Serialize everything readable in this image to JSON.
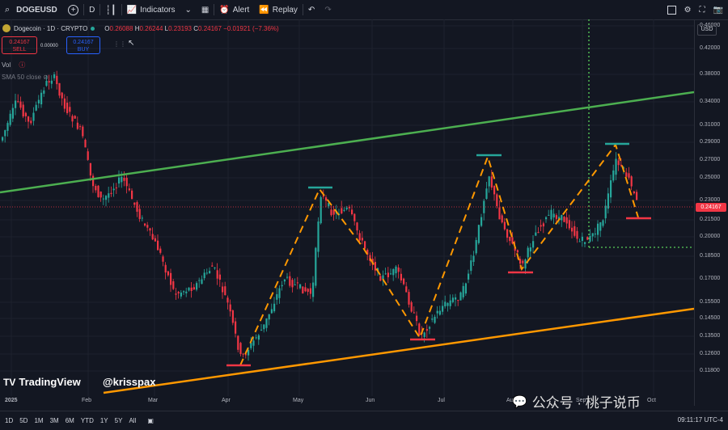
{
  "toolbar": {
    "symbol": "DOGEUSD",
    "interval": "D",
    "indicators_label": "Indicators",
    "alert_label": "Alert",
    "replay_label": "Replay"
  },
  "legend": {
    "title": "Dogecoin · 1D · CRYPTO",
    "o_key": "O",
    "o_val": "0.26088",
    "h_key": "H",
    "h_val": "0.26244",
    "l_key": "L",
    "l_val": "0.23193",
    "c_key": "C",
    "c_val": "0.24167",
    "change": "−0.01921 (−7.36%)"
  },
  "trade": {
    "sell_price": "0.24167",
    "sell_label": "SELL",
    "spread": "0.00000",
    "buy_price": "0.24167",
    "buy_label": "BUY"
  },
  "indicators": {
    "vol": "Vol",
    "sma": "SMA 50 close"
  },
  "price_axis": {
    "currency": "USD",
    "current": "0.24167",
    "labels": [
      "0.46000",
      "0.42000",
      "0.38000",
      "0.34000",
      "0.31000",
      "0.29000",
      "0.27000",
      "0.25000",
      "0.23000",
      "0.21500",
      "0.20000",
      "0.18500",
      "0.17000",
      "0.15500",
      "0.14500",
      "0.13500",
      "0.12600",
      "0.11800"
    ]
  },
  "time_axis": {
    "labels": [
      "2025",
      "Feb",
      "Mar",
      "Apr",
      "May",
      "Jun",
      "Jul",
      "Aug",
      "Sep",
      "Oct"
    ]
  },
  "bottombar": {
    "ranges": [
      "1D",
      "5D",
      "1M",
      "3M",
      "6M",
      "YTD",
      "1Y",
      "5Y",
      "All"
    ],
    "clock": "09:11:17 UTC-4"
  },
  "watermark": {
    "brand": "TradingView",
    "author": "@krisspax",
    "wechat": "公众号 · 桃子说币"
  },
  "colors": {
    "background": "#131722",
    "up": "#26a69a",
    "down": "#f23645",
    "channel_top": "#4caf50",
    "channel_bottom": "#ff9800",
    "zigzag": "#ff9800"
  },
  "chart_data": {
    "type": "candlestick",
    "x": [
      "2025-01",
      "2025-02",
      "2025-03",
      "2025-04",
      "2025-05",
      "2025-06",
      "2025-07",
      "2025-08",
      "2025-09",
      "2025-10"
    ],
    "ylim": [
      0.118,
      0.46
    ],
    "y_scale": "log",
    "last_close": 0.24167,
    "pivots": [
      {
        "type": "low",
        "value": 0.13
      },
      {
        "type": "high",
        "value": 0.26
      },
      {
        "type": "low",
        "value": 0.145
      },
      {
        "type": "high",
        "value": 0.295
      },
      {
        "type": "low",
        "value": 0.19
      },
      {
        "type": "high",
        "value": 0.31
      },
      {
        "type": "low",
        "value": 0.232
      }
    ],
    "horizontal_level": 0.205
  }
}
